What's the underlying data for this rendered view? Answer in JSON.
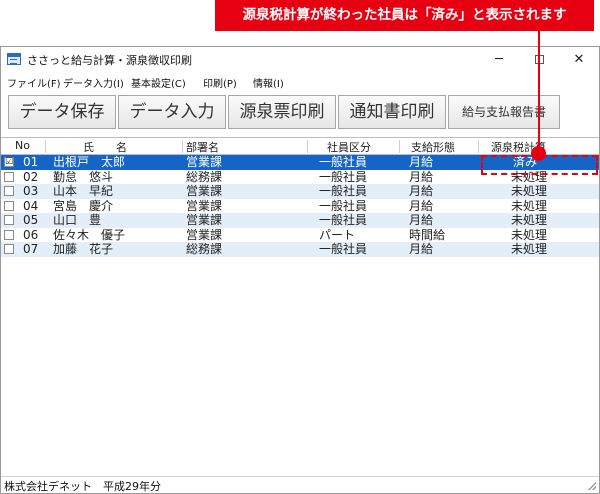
{
  "callout": {
    "text": "源泉税計算が終わった社員は「済み」と表示されます"
  },
  "window": {
    "title": "ささっと給与計算・源泉徴収印刷",
    "buttons": {
      "minimize": "─",
      "close": "✕"
    }
  },
  "menu": [
    "ファイル(F)",
    "データ入力(I)",
    "基本設定(C)",
    "印刷(P)",
    "情報(I)"
  ],
  "toolbar": [
    "データ保存",
    "データ入力",
    "源泉票印刷",
    "通知書印刷",
    "給与支払報告書"
  ],
  "table": {
    "headers": [
      "No",
      "氏　　名",
      "部署名",
      "社員区分",
      "支給形態",
      "源泉税計算"
    ],
    "rows": [
      {
        "check": "☑",
        "no": "01",
        "name": "出根戸　太郎",
        "dept": "営業課",
        "type": "一般社員",
        "pay": "月給",
        "status": "済み"
      },
      {
        "check": "",
        "no": "02",
        "name": "勤怠　悠斗",
        "dept": "総務課",
        "type": "一般社員",
        "pay": "月給",
        "status": "未処理"
      },
      {
        "check": "",
        "no": "03",
        "name": "山本　早紀",
        "dept": "営業課",
        "type": "一般社員",
        "pay": "月給",
        "status": "未処理"
      },
      {
        "check": "",
        "no": "04",
        "name": "宮島　慶介",
        "dept": "営業課",
        "type": "一般社員",
        "pay": "月給",
        "status": "未処理"
      },
      {
        "check": "",
        "no": "05",
        "name": "山口　豊",
        "dept": "営業課",
        "type": "一般社員",
        "pay": "月給",
        "status": "未処理"
      },
      {
        "check": "",
        "no": "06",
        "name": "佐々木　優子",
        "dept": "営業課",
        "type": "パート",
        "pay": "時間給",
        "status": "未処理"
      },
      {
        "check": "",
        "no": "07",
        "name": "加藤　花子",
        "dept": "総務課",
        "type": "一般社員",
        "pay": "月給",
        "status": "未処理"
      }
    ]
  },
  "status_bar": {
    "text": "株式会社デネット　平成29年分"
  },
  "colors": {
    "accent_red": "#e60012",
    "selection_blue": "#1565c9",
    "alt_row": "#e3eef9"
  }
}
